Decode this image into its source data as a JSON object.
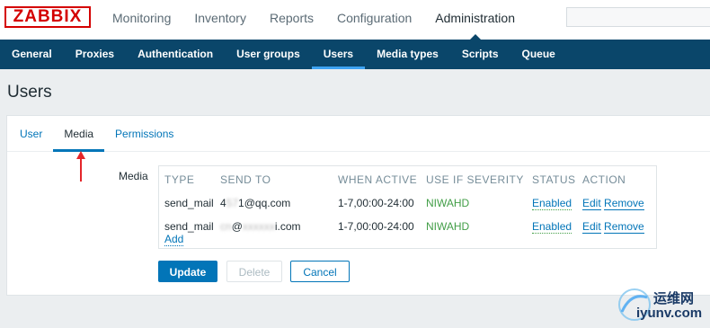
{
  "header": {
    "logo": "ZABBIX",
    "menu": [
      "Monitoring",
      "Inventory",
      "Reports",
      "Configuration",
      "Administration"
    ],
    "active_menu": "Administration"
  },
  "submenu": {
    "items": [
      "General",
      "Proxies",
      "Authentication",
      "User groups",
      "Users",
      "Media types",
      "Scripts",
      "Queue"
    ],
    "active": "Users"
  },
  "page": {
    "title": "Users"
  },
  "tabs": {
    "items": [
      "User",
      "Media",
      "Permissions"
    ],
    "active": "Media"
  },
  "media": {
    "label": "Media",
    "columns": [
      "TYPE",
      "SEND TO",
      "WHEN ACTIVE",
      "USE IF SEVERITY",
      "STATUS",
      "ACTION"
    ],
    "rows": [
      {
        "type": "send_mail",
        "send_to_prefix": "4",
        "send_to_hidden": "57",
        "send_to_suffix": "1@qq.com",
        "when_active": "1-7,00:00-24:00",
        "severity": "NIWAHD",
        "status": "Enabled",
        "edit": "Edit",
        "remove": "Remove"
      },
      {
        "type": "send_mail",
        "send_to_prefix": "",
        "send_to_hidden": "cn",
        "send_to_suffix": "@",
        "send_to_hidden2": "xxxxxx",
        "send_to_tail": "i.com",
        "when_active": "1-7,00:00-24:00",
        "severity": "NIWAHD",
        "status": "Enabled",
        "edit": "Edit",
        "remove": "Remove"
      }
    ],
    "add": "Add"
  },
  "buttons": {
    "update": "Update",
    "delete": "Delete",
    "cancel": "Cancel"
  },
  "watermark": {
    "cn": "运维网",
    "en": "iyunv.com"
  },
  "colors": {
    "accent": "#0275b8",
    "nav": "#0a466a",
    "status_green": "#429e47",
    "logo_red": "#d40000",
    "arrow_red": "#e4262a"
  }
}
